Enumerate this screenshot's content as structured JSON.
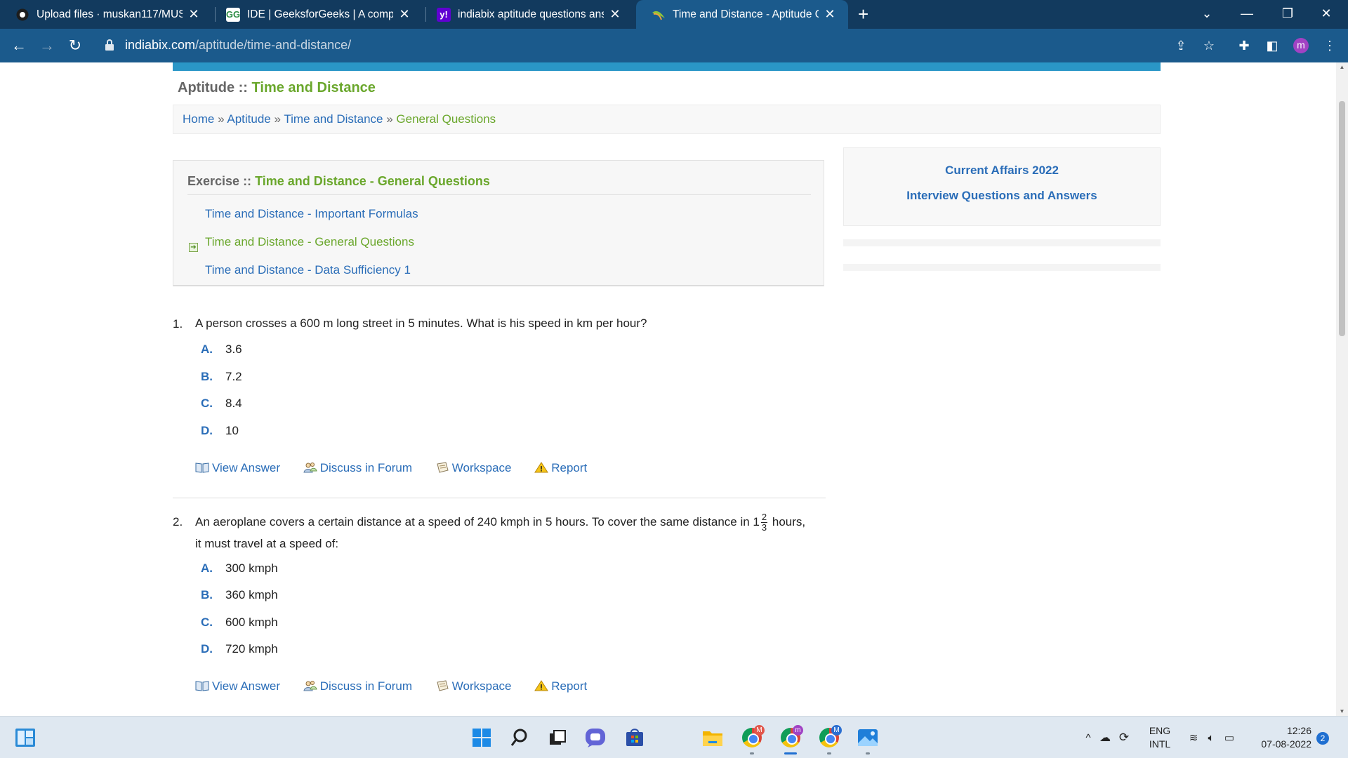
{
  "browser": {
    "tabs": [
      {
        "title": "Upload files · muskan117/MUSKA",
        "icon": "github-icon"
      },
      {
        "title": "IDE | GeeksforGeeks | A compute",
        "icon": "gfg-icon"
      },
      {
        "title": "indiabix aptitude questions answ",
        "icon": "yahoo-icon"
      },
      {
        "title": "Time and Distance - Aptitude Qu",
        "icon": "indiabix-icon"
      }
    ],
    "url_host": "indiabix.com",
    "url_path": "/aptitude/time-and-distance/",
    "profile_initial": "m"
  },
  "page": {
    "title_prefix": "Aptitude ::",
    "title_main": "Time and Distance",
    "breadcrumb": {
      "home": "Home",
      "sep": "»",
      "aptitude": "Aptitude",
      "topic": "Time and Distance",
      "current": "General Questions"
    },
    "exercise": {
      "prefix": "Exercise ::",
      "title": "Time and Distance - General Questions",
      "links": [
        "Time and Distance - Important Formulas",
        "Time and Distance - General Questions",
        "Time and Distance - Data Sufficiency 1"
      ]
    },
    "sidebar": {
      "link1": "Current Affairs 2022",
      "link2": "Interview Questions and Answers"
    },
    "questions": [
      {
        "num": "1.",
        "text": "A person crosses a 600 m long street in 5 minutes. What is his speed in km per hour?",
        "options": [
          {
            "letter": "A.",
            "value": "3.6"
          },
          {
            "letter": "B.",
            "value": "7.2"
          },
          {
            "letter": "C.",
            "value": "8.4"
          },
          {
            "letter": "D.",
            "value": "10"
          }
        ]
      },
      {
        "num": "2.",
        "text_a": "An aeroplane covers a certain distance at a speed of 240 kmph in 5 hours. To cover the same distance in 1",
        "frac_num": "2",
        "frac_den": "3",
        "text_b": "hours,",
        "text_c": "it must travel at a speed of:",
        "options": [
          {
            "letter": "A.",
            "value": "300 kmph"
          },
          {
            "letter": "B.",
            "value": "360 kmph"
          },
          {
            "letter": "C.",
            "value": "600 kmph"
          },
          {
            "letter": "D.",
            "value": "720 kmph"
          }
        ]
      }
    ],
    "actions": {
      "view": "View Answer",
      "discuss": "Discuss in Forum",
      "workspace": "Workspace",
      "report": "Report"
    }
  },
  "taskbar": {
    "lang_top": "ENG",
    "lang_bottom": "INTL",
    "time": "12:26",
    "date": "07-08-2022",
    "notifications": "2",
    "chrome_badges": [
      "M",
      "m",
      "M"
    ]
  },
  "colors": {
    "accent_green": "#6aa72c",
    "link_blue": "#2a6db8",
    "chrome_dark": "#123a5e",
    "chrome_toolbar": "#1b5a8c"
  }
}
